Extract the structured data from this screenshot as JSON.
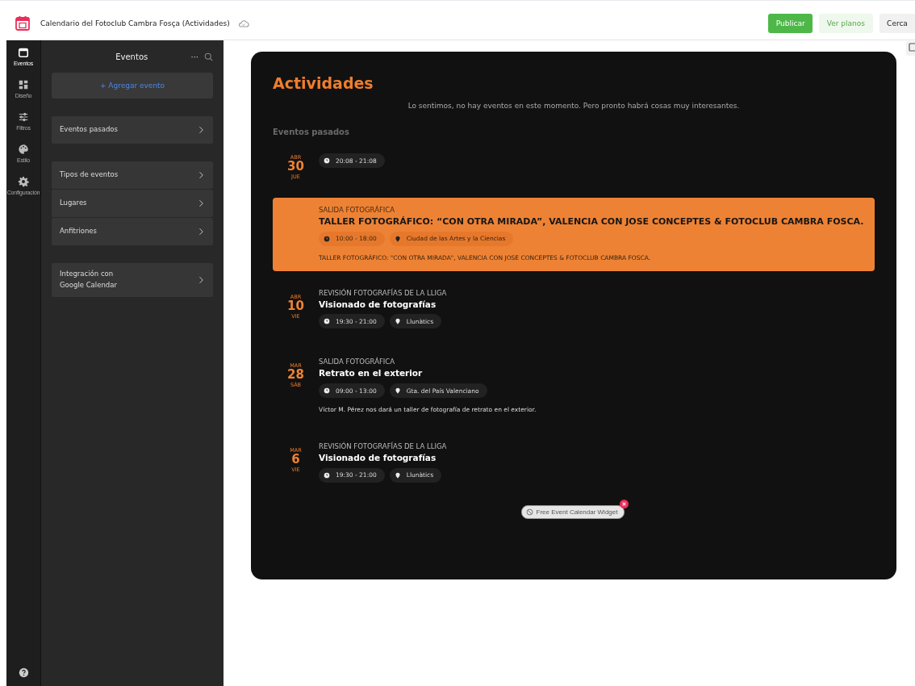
{
  "header": {
    "title": "Calendario del Fotoclub Cambra Fosça (Actividades)",
    "buttons": [
      {
        "label": "Publicar",
        "kind": "primary"
      },
      {
        "label": "Ver planos",
        "kind": "soft"
      },
      {
        "label": "Cerca",
        "kind": "plain"
      }
    ]
  },
  "rail": [
    {
      "label": "Eventos",
      "selected": true
    },
    {
      "label": "Diseño",
      "selected": false
    },
    {
      "label": "Filtros",
      "selected": false
    },
    {
      "label": "Estilo",
      "selected": false
    },
    {
      "label": "Configuración",
      "selected": false
    }
  ],
  "sidebar": {
    "title": "Eventos",
    "more": "···",
    "add_button": "+ Agregar evento",
    "groups": [
      [
        "Eventos pasados"
      ],
      [
        "Tipos de eventos",
        "Lugares",
        "Anfitriones"
      ],
      [
        "Integración con Google Calendar"
      ]
    ]
  },
  "widget": {
    "title": "Actividades",
    "empty_message": "Lo sentimos, no hay eventos en este momento. Pero pronto habrá cosas muy interesantes.",
    "section": "Eventos pasados",
    "events": [
      {
        "month": "ABR",
        "day": "30",
        "weekday": "JUE",
        "highlighted": false,
        "time": "20:08 - 21:08"
      },
      {
        "highlighted": true,
        "category": "SALIDA FOTOGRÁFICA",
        "title": "TALLER FOTOGRÁFICO: “CON OTRA MIRADA”, VALENCIA CON JOSE CONCEPTES & FOTOCLUB CAMBRA FOSCA.",
        "time": "10:00 - 18:00",
        "place": "Ciudad de las Artes y la Ciencias",
        "description": "TALLER FOTOGRÁFICO: \"CON OTRA MIRADA\", VALENCIA CON JOSE CONCEPTES & FOTOCLUB CAMBRA FOSCA."
      },
      {
        "month": "ABR",
        "day": "10",
        "weekday": "VIE",
        "highlighted": false,
        "category": "REVISIÓN FOTOGRAFÍAS DE LA LLIGA",
        "title": "Visionado de fotografías",
        "time": "19:30 - 21:00",
        "place": "Llunàtics"
      },
      {
        "month": "MAR",
        "day": "28",
        "weekday": "SÁB",
        "highlighted": false,
        "category": "SALIDA FOTOGRÁFICA",
        "title": "Retrato en el exterior",
        "time": "09:00 - 13:00",
        "place": "Gta. del País Valenciano",
        "description": "Víctor M. Pérez nos dará un taller de fotografía de retrato en el exterior."
      },
      {
        "month": "MAR",
        "day": "6",
        "weekday": "VIE",
        "highlighted": false,
        "category": "REVISIÓN FOTOGRAFÍAS DE LA LLIGA",
        "title": "Visionado de fotografías",
        "time": "19:30 - 21:00",
        "place": "Llunàtics"
      }
    ],
    "badge": "Free Event Calendar Widget"
  }
}
